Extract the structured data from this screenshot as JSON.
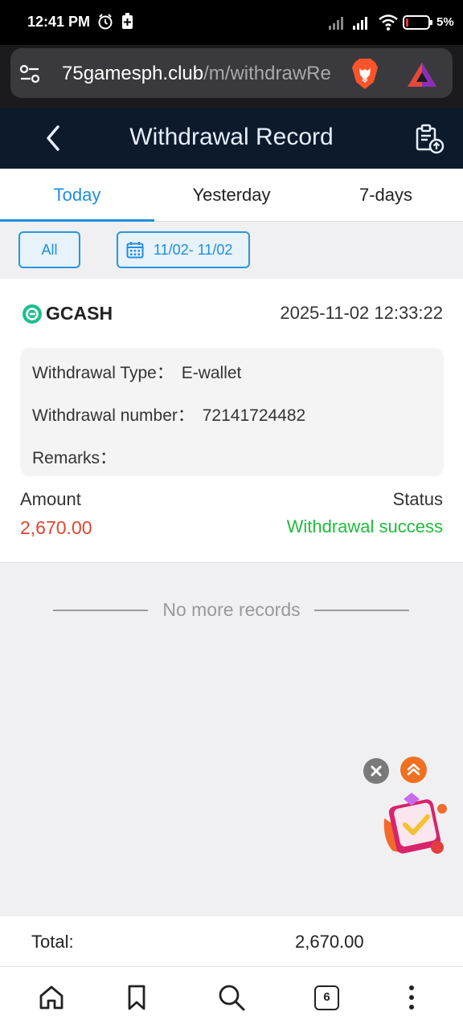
{
  "status_bar": {
    "time": "12:41 PM",
    "battery_percent": "5%"
  },
  "browser": {
    "url_domain": "75gamesph.club",
    "url_path": "/m/withdrawRe",
    "tab_count": "6"
  },
  "header": {
    "title": "Withdrawal Record"
  },
  "tabs": [
    {
      "label": "Today",
      "active": true
    },
    {
      "label": "Yesterday",
      "active": false
    },
    {
      "label": "7-days",
      "active": false
    }
  ],
  "filters": {
    "all_label": "All",
    "date_range": "11/02- 11/02"
  },
  "record": {
    "method": "GCASH",
    "datetime": "2025-11-02 12:33:22",
    "type_label": "Withdrawal Type：",
    "type_value": "E-wallet",
    "number_label": "Withdrawal number：",
    "number_value": "72141724482",
    "remarks_label": "Remarks：",
    "remarks_value": "",
    "amount_label": "Amount",
    "amount_value": "2,670.00",
    "status_label": "Status",
    "status_value": "Withdrawal success"
  },
  "no_more_text": "No more records",
  "total": {
    "label": "Total:",
    "value": "2,670.00"
  },
  "colors": {
    "accent": "#1e8de0",
    "amount": "#e2452d",
    "success": "#1fbd3b",
    "header_bg": "#0d1a2b"
  }
}
